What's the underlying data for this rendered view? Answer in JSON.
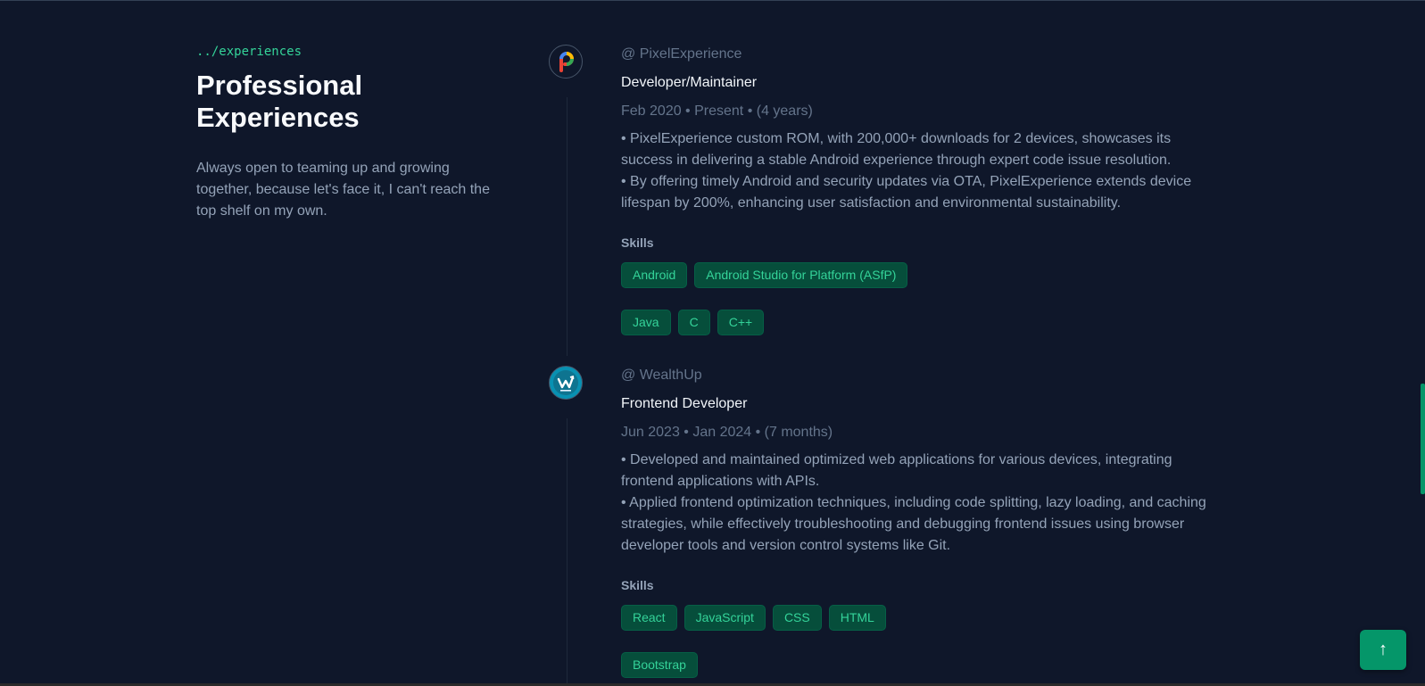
{
  "intro": {
    "breadcrumb": "../experiences",
    "title": "Professional Experiences",
    "description": "Always open to teaming up and growing together, because let's face it, I can't reach the top shelf on my own."
  },
  "experiences": [
    {
      "company": "@ PixelExperience",
      "role": "Developer/Maintainer",
      "dates": "Feb 2020 • Present • (4 years)",
      "bullets": [
        "• PixelExperience custom ROM, with 200,000+ downloads for 2 devices, showcases its success in delivering a stable Android experience through expert code issue resolution.",
        "• By offering timely Android and security updates via OTA, PixelExperience extends device lifespan by 200%, enhancing user satisfaction and environmental sustainability."
      ],
      "skills_label": "Skills",
      "skills": [
        "Android",
        "Android Studio for Platform (ASfP)",
        "Java",
        "C",
        "C++"
      ],
      "logo_icon": "pixelexperience-logo-icon"
    },
    {
      "company": "@ WealthUp",
      "role": "Frontend Developer",
      "dates": "Jun 2023 • Jan 2024 • (7 months)",
      "bullets": [
        "• Developed and maintained optimized web applications for various devices, integrating frontend applications with APIs.",
        "• Applied frontend optimization techniques, including code splitting, lazy loading, and caching strategies, while effectively troubleshooting and debugging frontend issues using browser developer tools and version control systems like Git."
      ],
      "skills_label": "Skills",
      "skills": [
        "React",
        "JavaScript",
        "CSS",
        "HTML",
        "Bootstrap"
      ],
      "logo_icon": "wealthup-logo-icon"
    }
  ],
  "scroll_top_button": {
    "icon": "arrow-up-icon",
    "glyph": "↑"
  },
  "colors": {
    "background": "#0f172a",
    "accent": "#34d399",
    "tag_bg": "#064e3b",
    "button_bg": "#059669"
  }
}
